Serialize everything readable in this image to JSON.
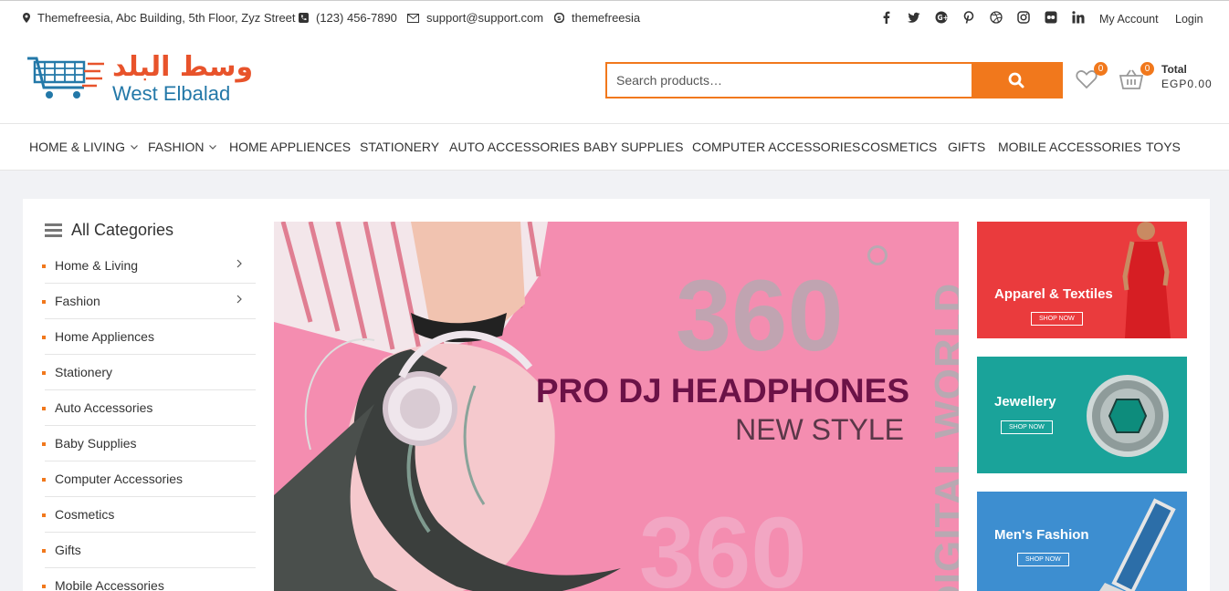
{
  "topbar": {
    "address": "Themefreesia, Abc Building, 5th Floor, Zyz Street",
    "phone": "(123) 456-7890",
    "email": "support@support.com",
    "skype": "themefreesia",
    "my_account": "My Account",
    "login": "Login",
    "social_icons": [
      "facebook-icon",
      "twitter-icon",
      "google-plus-icon",
      "pinterest-icon",
      "dribbble-icon",
      "instagram-icon",
      "flickr-icon",
      "linkedin-icon"
    ]
  },
  "header": {
    "logo_ar": "وسط البلد",
    "logo_en": "West Elbalad",
    "search_placeholder": "Search products…",
    "wishlist_count": "0",
    "cart_count": "0",
    "total_label": "Total",
    "total_value": "EGP0.00"
  },
  "nav": {
    "items": [
      {
        "label": "HOME & LIVING"
      },
      {
        "label": "FASHION"
      },
      {
        "label": "HOME APPLIENCES"
      },
      {
        "label": "STATIONERY"
      },
      {
        "label": "AUTO ACCESSORIES"
      },
      {
        "label": "BABY SUPPLIES"
      },
      {
        "label": "COMPUTER ACCESSORIES"
      },
      {
        "label": "COSMETICS"
      },
      {
        "label": "GIFTS"
      },
      {
        "label": "MOBILE ACCESSORIES"
      },
      {
        "label": "TOYS"
      }
    ]
  },
  "categories": {
    "title": "All Categories",
    "items": [
      {
        "label": "Home & Living"
      },
      {
        "label": "Fashion"
      },
      {
        "label": "Home Appliences"
      },
      {
        "label": "Stationery"
      },
      {
        "label": "Auto Accessories"
      },
      {
        "label": "Baby Supplies"
      },
      {
        "label": "Computer Accessories"
      },
      {
        "label": "Cosmetics"
      },
      {
        "label": "Gifts"
      },
      {
        "label": "Mobile Accessories"
      }
    ]
  },
  "hero": {
    "big_number": "360",
    "vertical_text": "DIGITAL WORLD",
    "title": "PRO DJ HEADPHONES",
    "subtitle": "NEW STYLE"
  },
  "banners": [
    {
      "title": "Apparel & Textiles",
      "button": "SHOP NOW",
      "color": "#e83a3a"
    },
    {
      "title": "Jewellery",
      "button": "SHOP NOW",
      "color": "#1aa39a"
    },
    {
      "title": "Men's Fashion",
      "button": "SHOP NOW",
      "color": "#3a86c8"
    }
  ],
  "colors": {
    "accent": "#f1781c",
    "brand_blue": "#2378a8",
    "brand_red": "#e8532b"
  }
}
